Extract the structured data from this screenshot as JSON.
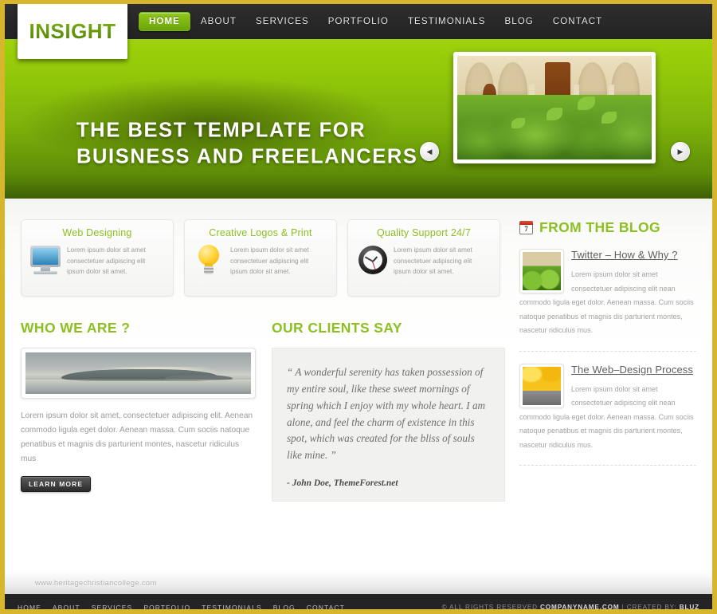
{
  "brand": {
    "logo_text": "INSIGHT",
    "accent_green": "#8cc021",
    "border_gold": "#d6b62c",
    "dark": "#242424"
  },
  "nav": {
    "items": [
      {
        "label": "HOME",
        "active": true
      },
      {
        "label": "ABOUT",
        "active": false
      },
      {
        "label": "SERVICES",
        "active": false
      },
      {
        "label": "PORTFOLIO",
        "active": false
      },
      {
        "label": "TESTIMONIALS",
        "active": false
      },
      {
        "label": "BLOG",
        "active": false
      },
      {
        "label": "CONTACT",
        "active": false
      }
    ]
  },
  "hero": {
    "title_line1": "THE BEST TEMPLATE FOR",
    "title_line2": "BUISNESS AND FREELANCERS",
    "prev_icon": "chevron-left-icon",
    "next_icon": "chevron-right-icon",
    "prev_glyph": "◀",
    "next_glyph": "▶",
    "image_alt": "green shrubs in front of an arched stone courtyard"
  },
  "features": [
    {
      "title": "Web Designing",
      "icon": "monitor-icon",
      "text": "Lorem ipsum dolor sit amet consectetuer adipiscing elit ipsum dolor sit amet."
    },
    {
      "title": "Creative Logos & Print",
      "icon": "lightbulb-icon",
      "text": "Lorem ipsum dolor sit amet consectetuer adipiscing elit ipsum dolor sit amet."
    },
    {
      "title": "Quality Support 24/7",
      "icon": "clock-icon",
      "text": "Lorem ipsum dolor sit amet consectetuer adipiscing elit ipsum dolor sit amet."
    }
  ],
  "who_we_are": {
    "title": "WHO WE ARE ?",
    "image_alt": "hazy island in the sea at sunset",
    "text": "Lorem ipsum dolor sit amet, consectetuer adipiscing elit. Aenean commodo ligula eget dolor. Aenean massa. Cum sociis natoque penatibus et magnis dis parturient montes, nascetur ridiculus mus",
    "button_label": "LEARN MORE"
  },
  "clients": {
    "title": "OUR CLIENTS SAY",
    "quote": "“ A wonderful serenity has taken possession of my entire soul, like these sweet mornings of spring which I enjoy with my whole heart. I am alone, and feel the charm of existence in this spot, which was created for the bliss of souls like mine. ”",
    "author": "- John Doe, ThemeForest.net"
  },
  "blog": {
    "title": "FROM THE BLOG",
    "icon": "calendar-icon",
    "calendar_day": "7",
    "posts": [
      {
        "title": "Twitter – How & Why ?",
        "thumb_alt": "green shrubs thumbnail",
        "text": "Lorem ipsum dolor sit amet consectetuer adipiscing elit nean commodo ligula eget dolor. Aenean massa. Cum sociis natoque penatibus et magnis dis parturient montes, nascetur ridiculus mus."
      },
      {
        "title": "The Web–Design Process",
        "thumb_alt": "autumn yellow trees thumbnail",
        "text": "Lorem ipsum dolor sit amet consectetuer adipiscing elit nean commodo ligula eget dolor. Aenean massa. Cum sociis natoque penatibus et magnis dis parturient montes, nascetur ridiculus mus."
      }
    ]
  },
  "watermark": "www.heritagechristiancollege.com",
  "footer": {
    "links": [
      "HOME",
      "ABOUT",
      "SERVICES",
      "PORTFOLIO",
      "TESTIMONIALS",
      "BLOG",
      "CONTACT"
    ],
    "copyright_prefix": "© ALL RIGHTS RESERVED ",
    "company": "COMPANYNAME.COM",
    "separator": " | CREATED BY: ",
    "author": "BLUZ"
  }
}
